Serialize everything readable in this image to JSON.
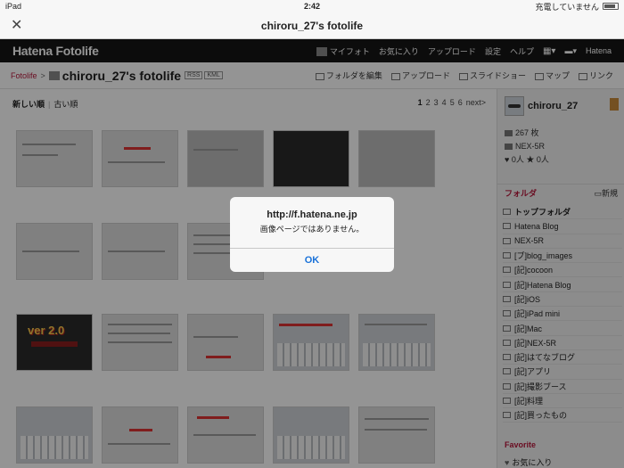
{
  "statusbar": {
    "device": "iPad",
    "time": "2:42",
    "charging": "充電していません"
  },
  "navbar": {
    "close": "✕",
    "title": "chiroru_27's fotolife"
  },
  "hatena": {
    "logo": "Hatena Fotolife",
    "menu": [
      "マイフォト",
      "お気に入り",
      "アップロード",
      "設定",
      "ヘルプ"
    ],
    "brand": "Hatena"
  },
  "breadcrumb": {
    "root": "Fotolife",
    "sep": ">",
    "title": "chiroru_27's fotolife",
    "tags": [
      "RSS",
      "KML"
    ],
    "tools": [
      "フォルダを編集",
      "アップロード",
      "スライドショー",
      "マップ",
      "リンク"
    ]
  },
  "sort": {
    "newest": "新しい順",
    "oldest": "古い順"
  },
  "pager": {
    "pages": [
      "1",
      "2",
      "3",
      "4",
      "5",
      "6"
    ],
    "next": "next>"
  },
  "thumbnails": {
    "ver_label": "ver 2.0"
  },
  "sidebar": {
    "username": "chiroru_27",
    "photos": "267 枚",
    "camera": "NEX-5R",
    "fans": "0人",
    "stars": "0人",
    "folders_label": "フォルダ",
    "new_label": "新規",
    "folders": [
      "トップフォルダ",
      "Hatena Blog",
      "NEX-5R",
      "[ブ]blog_images",
      "[記]cocoon",
      "[記]Hatena Blog",
      "[記]iOS",
      "[記]iPad mini",
      "[記]Mac",
      "[記]NEX-5R",
      "[記]はてなブログ",
      "[記]アプリ",
      "[記]撮影ブース",
      "[記]料理",
      "[記]買ったもの"
    ],
    "favorite_label": "Favorite",
    "favorite_item": "お気に入り"
  },
  "alert": {
    "title": "http://f.hatena.ne.jp",
    "message": "画像ページではありません。",
    "ok": "OK"
  }
}
